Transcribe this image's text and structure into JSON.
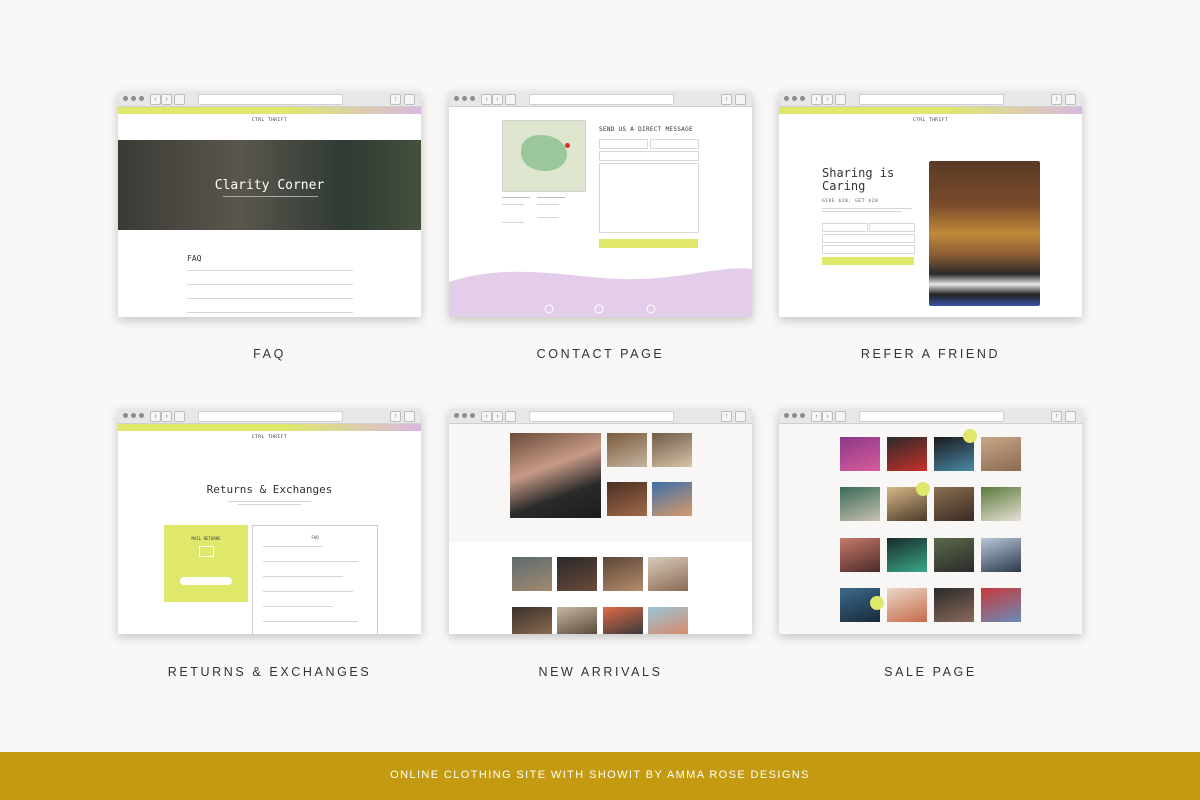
{
  "cards": {
    "faq": {
      "caption": "FAQ",
      "hero_title": "Clarity Corner",
      "section_title": "FAQ",
      "logo": "CTRL THRIFT"
    },
    "contact": {
      "caption": "CONTACT PAGE",
      "heading": "SEND US A DIRECT MESSAGE"
    },
    "refer": {
      "caption": "REFER A FRIEND",
      "title": "Sharing is Caring",
      "offer": "GIVE $20, GET $20",
      "logo": "CTRL THRIFT"
    },
    "returns": {
      "caption": "RETURNS & EXCHANGES",
      "title": "Returns & Exchanges",
      "mail_heading": "MAIL RETURNS",
      "faq_heading": "FAQ",
      "logo": "CTRL THRIFT"
    },
    "arrivals": {
      "caption": "NEW ARRIVALS"
    },
    "sale": {
      "caption": "SALE PAGE"
    }
  },
  "footer": {
    "text": "ONLINE CLOTHING SITE WITH SHOWIT BY AMMA ROSE DESIGNS"
  },
  "colors": {
    "background": "#f9f8f6",
    "accent_lime": "#dfe86a",
    "accent_lilac": "#e4cde9",
    "footer_gold": "#c49b10"
  }
}
